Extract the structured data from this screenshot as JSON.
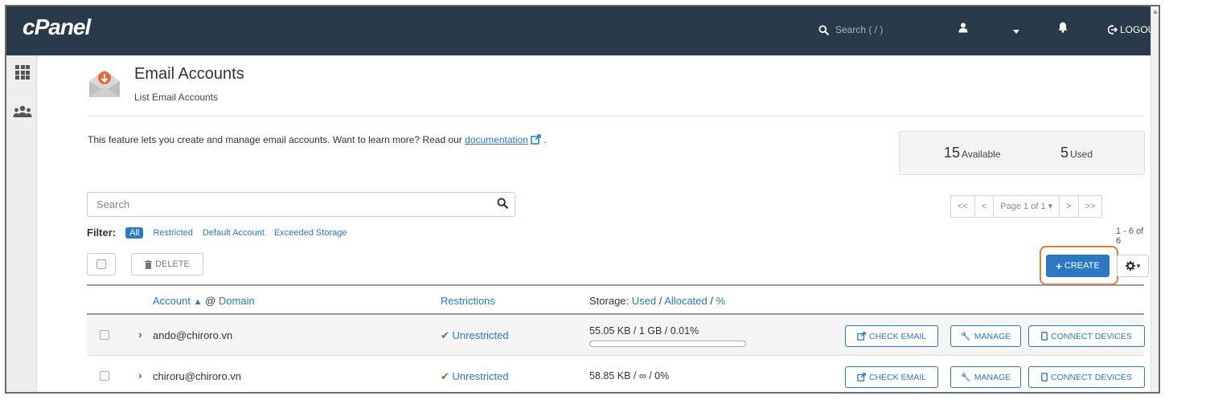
{
  "topbar": {
    "logo": "cPanel",
    "search_placeholder": "Search ( / )",
    "logout_label": "LOGOUT"
  },
  "header": {
    "title": "Email Accounts",
    "subtitle": "List Email Accounts"
  },
  "intro": {
    "text_before": "This feature lets you create and manage email accounts. Want to learn more? Read our ",
    "link_text": "documentation",
    "text_after": " ."
  },
  "stats": {
    "available_count": "15",
    "available_label": "Available",
    "used_count": "5",
    "used_label": "Used"
  },
  "search": {
    "placeholder": "Search"
  },
  "pager": {
    "first": "<<",
    "prev": "<",
    "page": "Page 1 of 1",
    "next": ">",
    "last": ">>"
  },
  "filter": {
    "label": "Filter:",
    "options": [
      "All",
      "Restricted",
      "Default Account",
      "Exceeded Storage"
    ]
  },
  "range_text": "1 - 6 of 6",
  "toolbar": {
    "delete_label": "DELETE",
    "create_label": "CREATE"
  },
  "table": {
    "headers": {
      "account": "Account",
      "at_sep": " @ ",
      "domain": "Domain",
      "restrictions": "Restrictions",
      "storage_prefix": "Storage: ",
      "storage_used": "Used",
      "storage_sep1": " / ",
      "storage_alloc": "Allocated",
      "storage_sep2": " / ",
      "storage_pct": "%"
    },
    "rows": [
      {
        "account": "ando@chiroro.vn",
        "restriction": "Unrestricted",
        "storage": "55.05 KB / 1 GB / 0.01%",
        "usage_fraction": 0.0001,
        "check_email": "CHECK EMAIL",
        "manage": "MANAGE",
        "connect": "CONNECT DEVICES"
      },
      {
        "account": "chiroru@chiroro.vn",
        "restriction": "Unrestricted",
        "storage": "58.85 KB / ∞ / 0%",
        "check_email": "CHECK EMAIL",
        "manage": "MANAGE",
        "connect": "CONNECT DEVICES"
      }
    ]
  },
  "colors": {
    "topbar": "#293a4a",
    "accent": "#2b78c5",
    "highlight": "#e67f2a",
    "success": "#3c8b3c"
  }
}
